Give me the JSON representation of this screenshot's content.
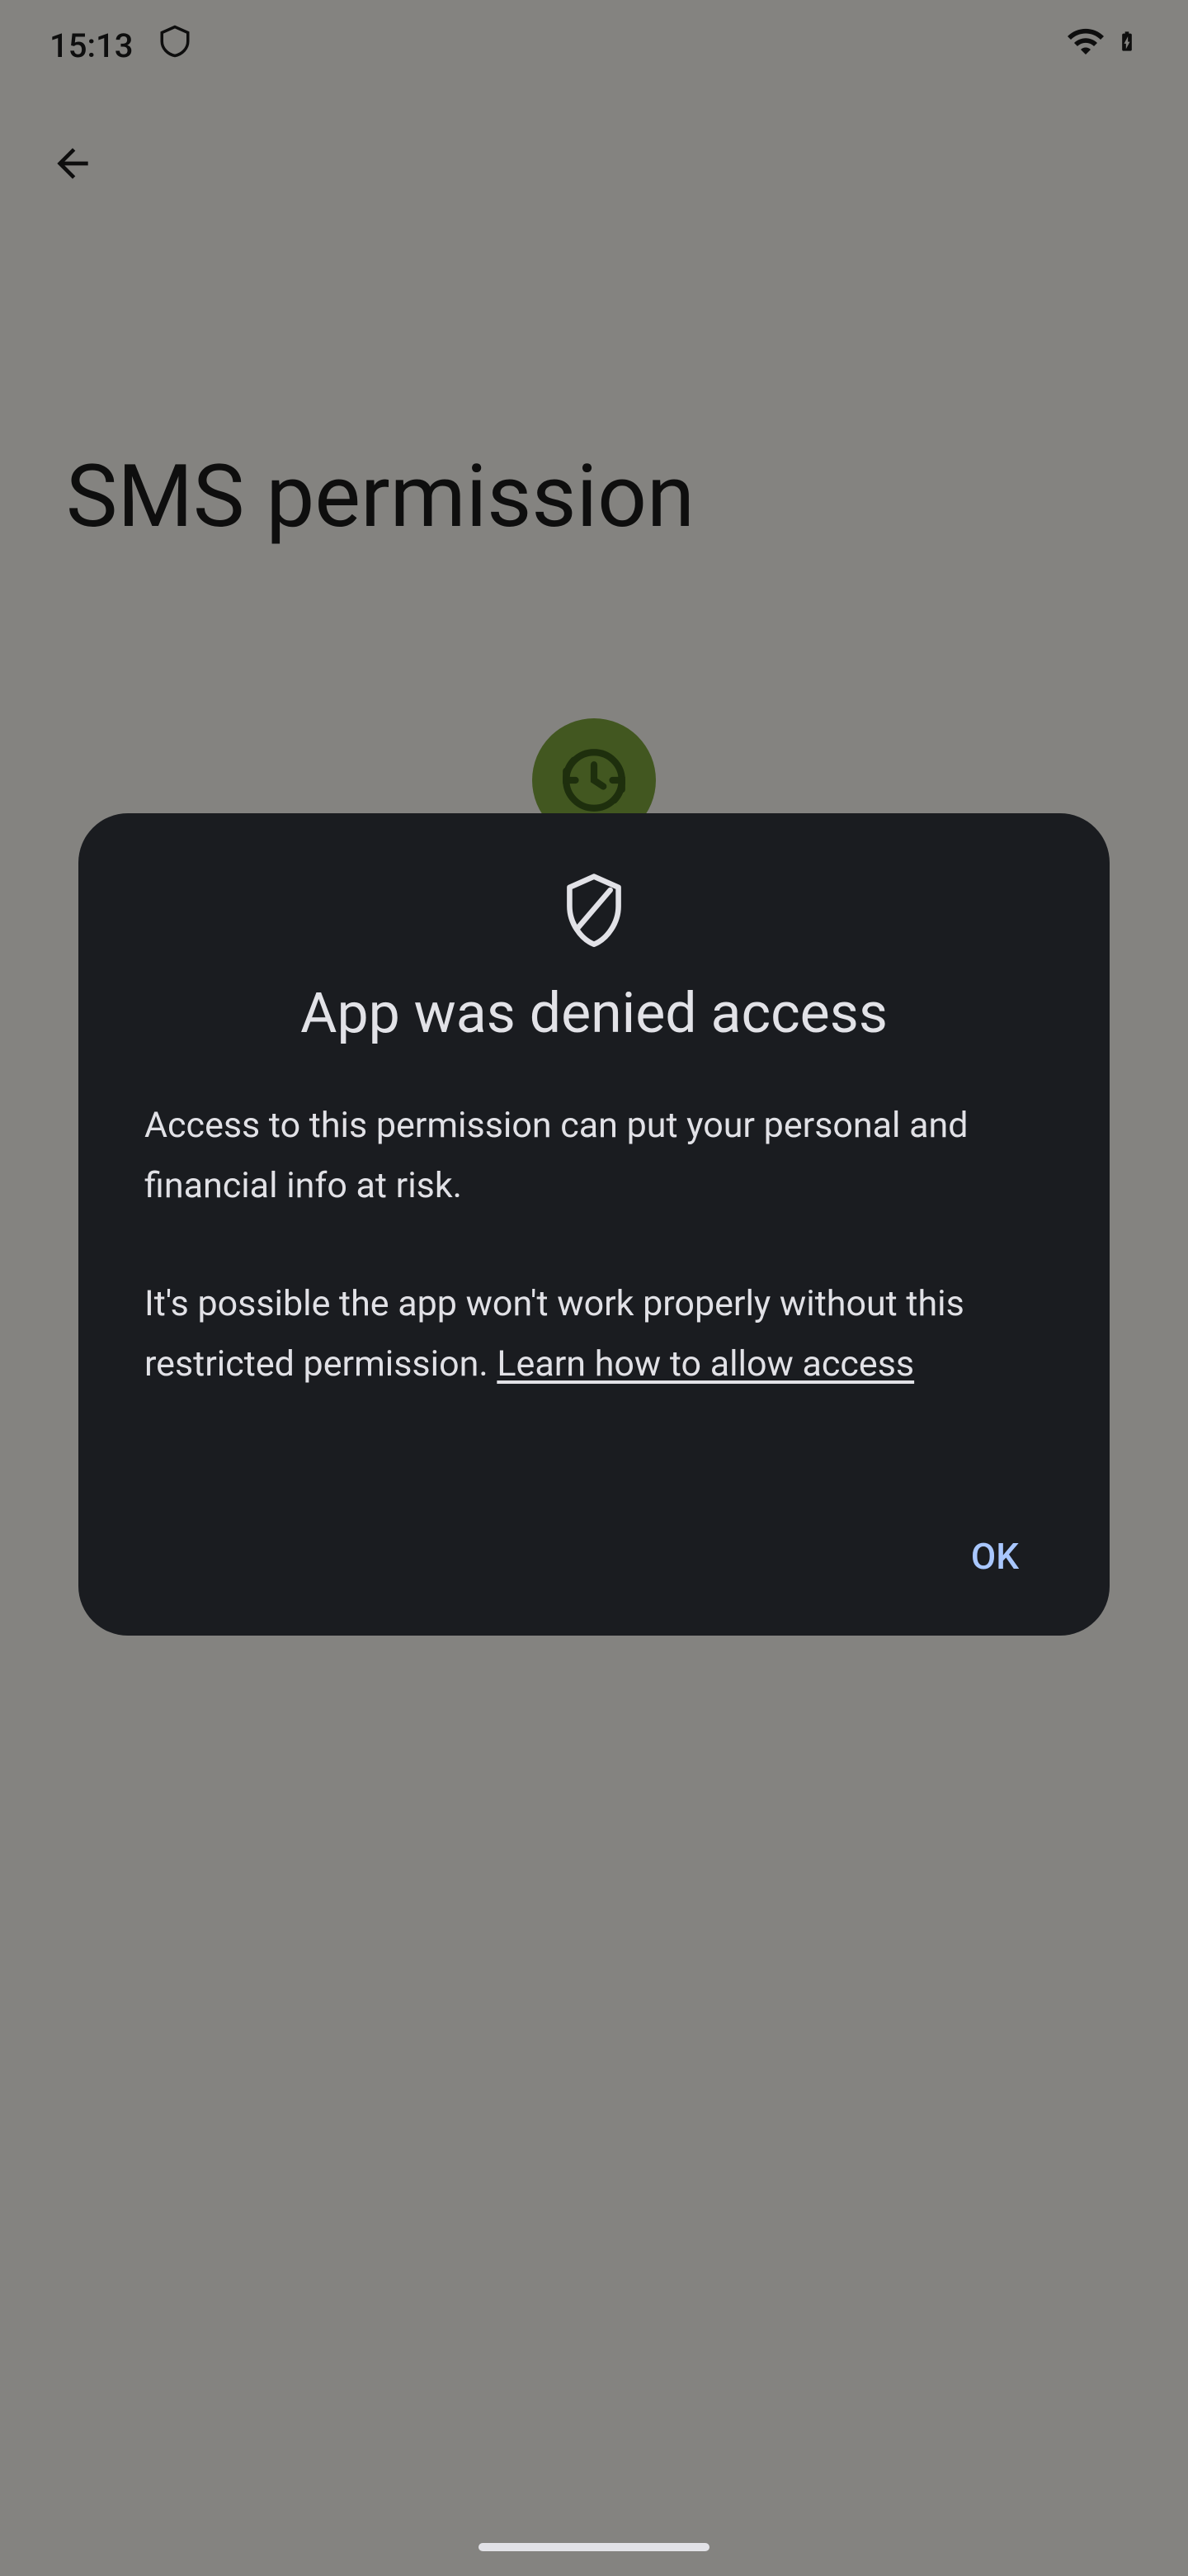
{
  "status_bar": {
    "time": "15:13"
  },
  "background": {
    "page_title": "SMS permission"
  },
  "dialog": {
    "title": "App was denied access",
    "body_paragraph_1": "Access to this permission can put your personal and financial info at risk.",
    "body_paragraph_2_prefix": "It's possible the app won't work properly without this restricted permission. ",
    "learn_more_label": "Learn how to allow access",
    "ok_label": "OK"
  }
}
